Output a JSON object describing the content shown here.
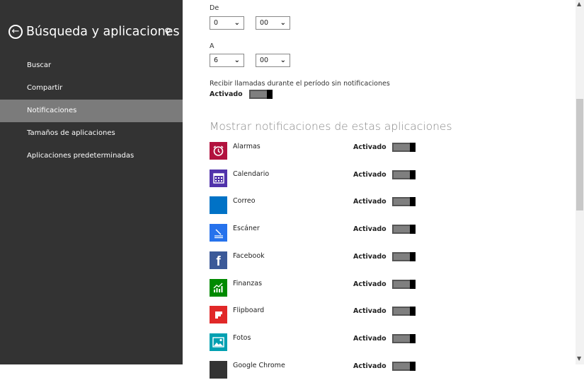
{
  "sidebar": {
    "title": "Búsqueda y aplicaciones",
    "back_icon": "back-arrow-icon",
    "search_icon": "search-icon",
    "items": [
      {
        "label": "Buscar",
        "active": false
      },
      {
        "label": "Compartir",
        "active": false
      },
      {
        "label": "Notificaciones",
        "active": true
      },
      {
        "label": "Tamaños de aplicaciones",
        "active": false
      },
      {
        "label": "Aplicaciones predeterminadas",
        "active": false
      }
    ]
  },
  "quiet_hours": {
    "from_label": "De",
    "from_hour": "0",
    "from_minute": "00",
    "to_label": "A",
    "to_hour": "6",
    "to_minute": "00",
    "calls_label": "Recibir llamadas durante el período sin notificaciones",
    "calls_state": "Activado",
    "calls_on": true
  },
  "apps_section": {
    "title": "Mostrar notificaciones de estas aplicaciones",
    "apps": [
      {
        "name": "Alarmas",
        "state": "Activado",
        "on": true,
        "color": "#b2123e",
        "icon": "alarm-clock-icon"
      },
      {
        "name": "Calendario",
        "state": "Activado",
        "on": true,
        "color": "#5133ab",
        "icon": "calendar-icon"
      },
      {
        "name": "Correo",
        "state": "Activado",
        "on": true,
        "color": "#0072c6",
        "icon": "mail-icon"
      },
      {
        "name": "Escáner",
        "state": "Activado",
        "on": true,
        "color": "#2672ec",
        "icon": "scanner-icon"
      },
      {
        "name": "Facebook",
        "state": "Activado",
        "on": true,
        "color": "#3b5998",
        "icon": "facebook-icon"
      },
      {
        "name": "Finanzas",
        "state": "Activado",
        "on": true,
        "color": "#008a00",
        "icon": "finance-chart-icon"
      },
      {
        "name": "Flipboard",
        "state": "Activado",
        "on": true,
        "color": "#e12828",
        "icon": "flipboard-icon"
      },
      {
        "name": "Fotos",
        "state": "Activado",
        "on": true,
        "color": "#00a0b1",
        "icon": "photos-icon"
      },
      {
        "name": "Google Chrome",
        "state": "Activado",
        "on": true,
        "color": "#333333",
        "icon": "chrome-icon"
      }
    ]
  },
  "colors": {
    "sidebar_bg": "#333333",
    "active_item_bg": "#7b7b7b",
    "section_title": "#888888"
  }
}
